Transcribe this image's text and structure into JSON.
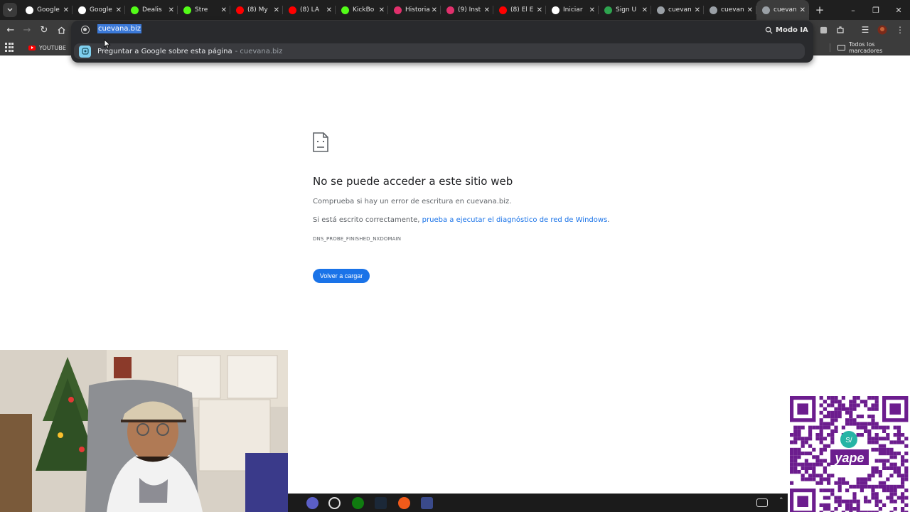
{
  "browser": {
    "tabs": [
      {
        "label": "Google",
        "icon": "google-icon",
        "color": "#ffffff"
      },
      {
        "label": "Google",
        "icon": "google-icon",
        "color": "#ffffff"
      },
      {
        "label": "Dealis",
        "icon": "kick-icon",
        "color": "#53fc18"
      },
      {
        "label": "Stre",
        "icon": "kick-icon",
        "color": "#53fc18"
      },
      {
        "label": "(8) My",
        "icon": "youtube-icon",
        "color": "#ff0000"
      },
      {
        "label": "(8) LA",
        "icon": "youtube-icon",
        "color": "#ff0000"
      },
      {
        "label": "KickBo",
        "icon": "kickbot-icon",
        "color": "#53fc18"
      },
      {
        "label": "Historia",
        "icon": "instagram-icon",
        "color": "#e1306c"
      },
      {
        "label": "(9) Inst",
        "icon": "instagram-icon",
        "color": "#e1306c"
      },
      {
        "label": "(8) El E",
        "icon": "youtube-icon",
        "color": "#ff0000"
      },
      {
        "label": "Iniciar",
        "icon": "github-icon",
        "color": "#ffffff"
      },
      {
        "label": "Sign U",
        "icon": "signup-icon",
        "color": "#2ea44f"
      },
      {
        "label": "cuevan",
        "icon": "globe-icon",
        "color": "#9aa0a6"
      },
      {
        "label": "cuevan",
        "icon": "globe-icon",
        "color": "#9aa0a6"
      },
      {
        "label": "cuevan",
        "icon": "globe-icon",
        "color": "#9aa0a6",
        "active": true
      }
    ],
    "modo_ia": "Modo IA",
    "omnibox": {
      "url": "cuevana.biz",
      "suggestion_main": "Preguntar a Google sobre esta página",
      "suggestion_sub": "- cuevana.biz"
    },
    "bookmarks": {
      "youtube": "YOUTUBE",
      "all_bookmarks": "Todos los marcadores"
    }
  },
  "error_page": {
    "title": "No se puede acceder a este sitio web",
    "line1": "Comprueba si hay un error de escritura en cuevana.biz.",
    "line2_prefix": "Si está escrito correctamente, ",
    "line2_link": "prueba a ejecutar el diagnóstico de red de Windows",
    "line2_suffix": ".",
    "error_code": "DNS_PROBE_FINISHED_NXDOMAIN",
    "reload_button": "Volver a cargar"
  },
  "overlays": {
    "qr_logo": "yape",
    "qr_badge": "S/"
  },
  "colors": {
    "accent": "#1a73e8",
    "tabstrip": "#1f1f1f",
    "toolbar": "#3c3c3c",
    "qr": "#6c1d8e"
  }
}
